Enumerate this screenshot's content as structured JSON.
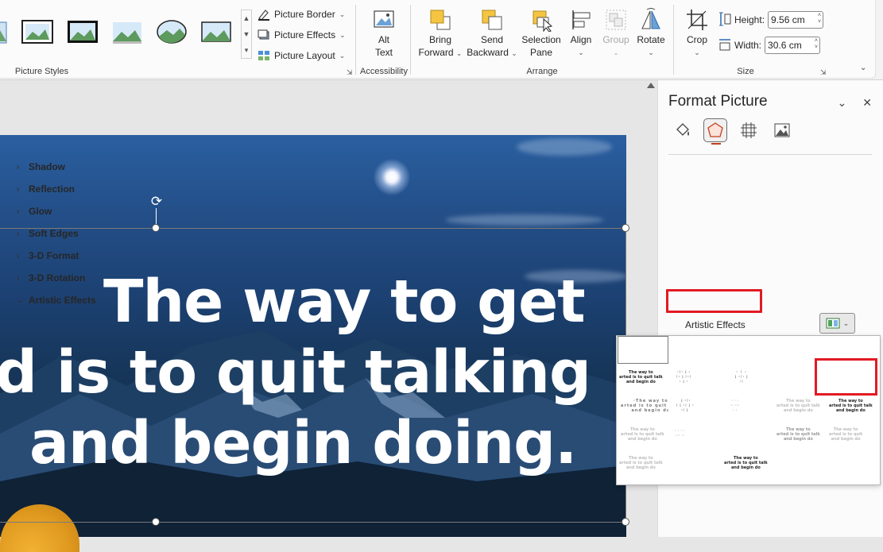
{
  "ribbon": {
    "picture_styles": {
      "group_label": "Picture Styles",
      "border_label": "Picture Border",
      "effects_label": "Picture Effects",
      "layout_label": "Picture Layout"
    },
    "accessibility": {
      "group_label": "Accessibility",
      "alt_text_line1": "Alt",
      "alt_text_line2": "Text"
    },
    "arrange": {
      "group_label": "Arrange",
      "bring_forward_line1": "Bring",
      "bring_forward_line2": "Forward",
      "send_backward_line1": "Send",
      "send_backward_line2": "Backward",
      "selection_pane_line1": "Selection",
      "selection_pane_line2": "Pane",
      "align_label": "Align",
      "group_btn_label": "Group",
      "rotate_label": "Rotate"
    },
    "size": {
      "group_label": "Size",
      "crop_label": "Crop",
      "height_label": "Height:",
      "height_value": "9.56 cm",
      "width_label": "Width:",
      "width_value": "30.6 cm"
    }
  },
  "slide": {
    "quote_line1": "The way to get",
    "quote_line2": "d is to quit  talking",
    "quote_line3": "and begin doing."
  },
  "format_pane": {
    "title": "Format Picture",
    "sections": [
      {
        "label": "Shadow",
        "expanded": false
      },
      {
        "label": "Reflection",
        "expanded": false
      },
      {
        "label": "Glow",
        "expanded": false
      },
      {
        "label": "Soft Edges",
        "expanded": false
      },
      {
        "label": "3-D Format",
        "expanded": false
      },
      {
        "label": "3-D Rotation",
        "expanded": false
      },
      {
        "label": "Artistic Effects",
        "expanded": true
      }
    ],
    "artistic_effects_label": "Artistic Effects"
  },
  "gallery": {
    "thumb_line1": "The way to",
    "thumb_line2": "arted is to quit talk",
    "thumb_line3": "and begin do"
  },
  "colors": {
    "highlight_red": "#e21a23",
    "accent": "#c43e1c"
  }
}
